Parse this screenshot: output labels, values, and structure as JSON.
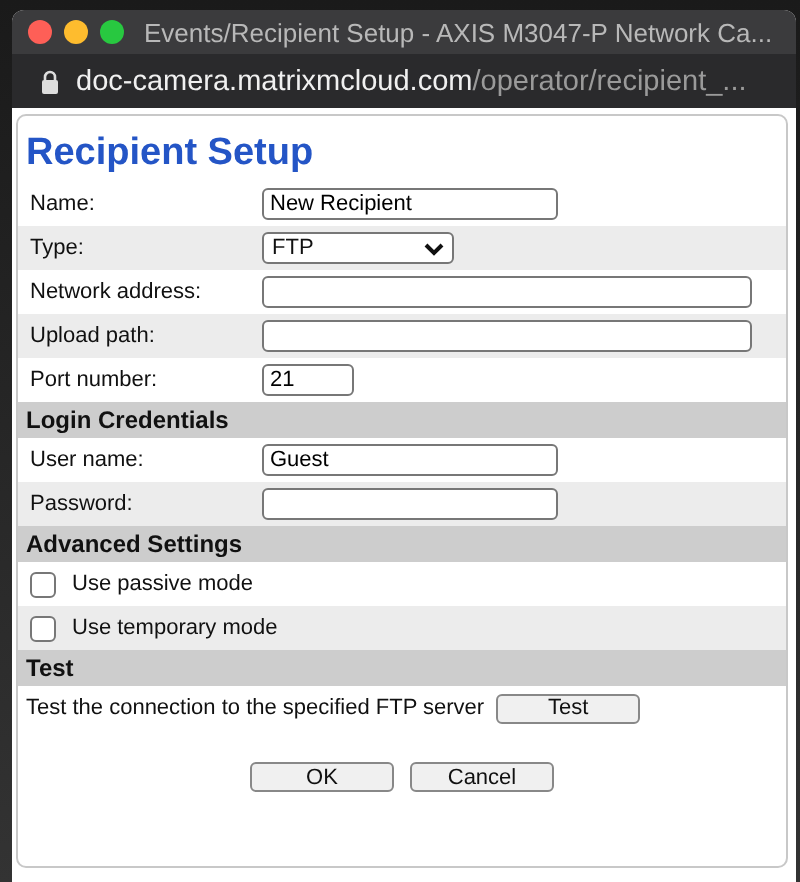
{
  "window": {
    "title": "Events/Recipient Setup - AXIS M3047-P Network Ca...",
    "url_host": "doc-camera.matrixmcloud.com",
    "url_path": "/operator/recipient_..."
  },
  "dialog": {
    "heading": "Recipient Setup",
    "sections": [
      {
        "rows": [
          {
            "kind": "short-field",
            "label": "Name:",
            "value": "New Recipient"
          },
          {
            "kind": "select",
            "label": "Type:",
            "value": "FTP"
          },
          {
            "kind": "long-field",
            "label": "Network address:"
          },
          {
            "kind": "long-field",
            "label": "Upload path:"
          },
          {
            "kind": "number-field",
            "label": "Port number:",
            "value": "21"
          }
        ]
      },
      {
        "title": "Login Credentials",
        "rows": [
          {
            "kind": "short-field",
            "label": "User name:",
            "value": "Guest"
          },
          {
            "kind": "password-field",
            "label": "Password:"
          }
        ]
      },
      {
        "title": "Advanced Settings",
        "rows": [
          {
            "kind": "checkbox",
            "label": "Use passive mode",
            "checked": false
          },
          {
            "kind": "checkbox",
            "label": "Use temporary mode",
            "checked": false
          }
        ]
      },
      {
        "title": "Test",
        "rows": [
          {
            "kind": "action",
            "label": "Test the connection to the specified FTP server",
            "button": "Test"
          }
        ]
      }
    ],
    "buttons": [
      "OK",
      "Cancel"
    ]
  }
}
